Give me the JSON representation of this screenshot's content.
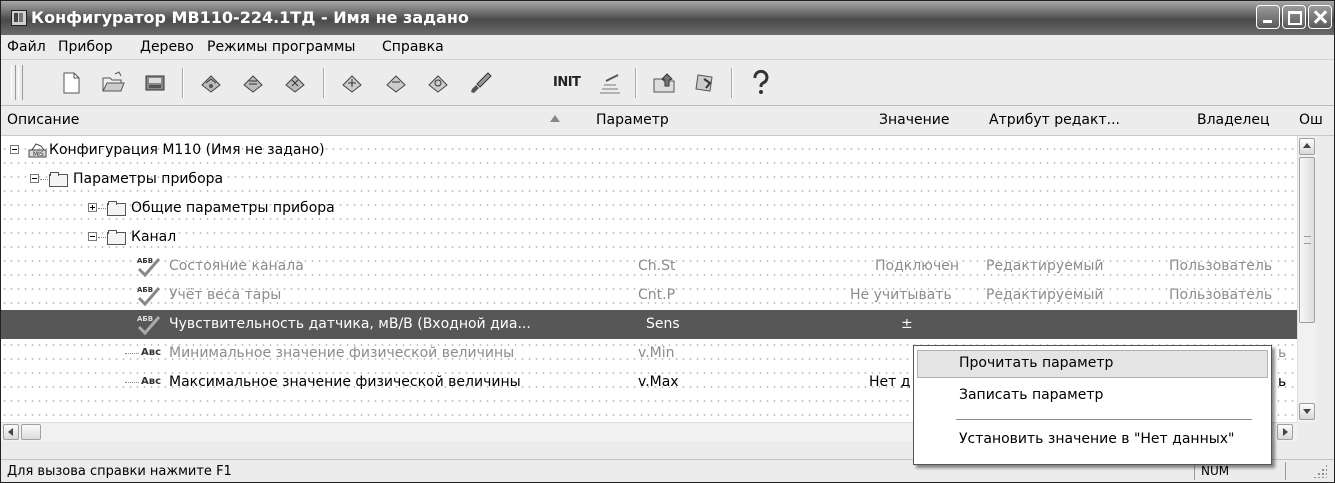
{
  "window": {
    "title": "Конфигуратор МВ110-224.1ТД - Имя не задано"
  },
  "menu": [
    "Файл",
    "Прибор",
    "Дерево",
    "Режимы программы",
    "Справка"
  ],
  "toolbar": {
    "init_label": "INIT"
  },
  "columns": {
    "description": "Описание",
    "parameter": "Параметр",
    "value": "Значение",
    "attribute": "Атрибут редакт...",
    "owner": "Владелец",
    "error": "Ош"
  },
  "tree": {
    "root": "Конфигурация М110 (Имя не задано)",
    "device_params": "Параметры прибора",
    "general_params": "Общие параметры прибора",
    "channel": "Канал",
    "rows": [
      {
        "label": "Состояние канала",
        "param": "Ch.St",
        "value": "Подключен",
        "attribute": "Редактируемый",
        "owner": "Пользователь"
      },
      {
        "label": "Учёт веса тары",
        "param": "Cnt.P",
        "value": "Не учитывать",
        "attribute": "Редактируемый",
        "owner": "Пользователь"
      },
      {
        "label": "Чувствительность датчика, мВ/В (Входной диа...",
        "param": "Sens",
        "value": "±",
        "attribute": "",
        "owner": ""
      },
      {
        "label": "Минимальное значение физической величины",
        "param": "v.Min",
        "value": "",
        "attribute": "",
        "owner": "ь"
      },
      {
        "label": "Максимальное значение физической величины",
        "param": "v.Max",
        "value": "Нет д",
        "attribute": "",
        "owner": "ь"
      }
    ],
    "abc_tag": "Авс",
    "check_tag": "АБВ"
  },
  "context_menu": {
    "read": "Прочитать параметр",
    "write": "Записать параметр",
    "set_no_data": "Установить значение в \"Нет данных\""
  },
  "status": {
    "hint": "Для вызова справки нажмите F1",
    "num": "NUM"
  }
}
